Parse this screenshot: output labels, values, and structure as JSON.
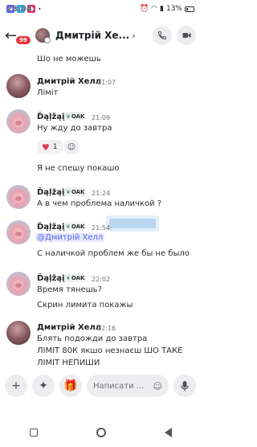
{
  "status_bar": {
    "time": "23:04",
    "battery": "13%"
  },
  "header": {
    "badge": "99",
    "title": "Дмитрій Хе..."
  },
  "messages": [
    {
      "text": "Шо не можешь"
    },
    {
      "author": "Дмитрій Хелл",
      "time": "21:07",
      "text": "Ліміт"
    },
    {
      "author": "Ďąļžąį",
      "tag": "OAK",
      "time": "21:09",
      "text": "Ну жду до завтра",
      "reaction_count": "1"
    },
    {
      "text": "Я не спешу покашо"
    },
    {
      "author": "Ďąļžąį",
      "tag": "OAK",
      "time": "21:24",
      "text": "А в чем проблема наличкой ?"
    },
    {
      "author": "Ďąļžąį",
      "tag": "OAK",
      "time": "21:54",
      "mention": "@Дмитрій Хелл",
      "text": "С наличкой проблем же бы не было"
    },
    {
      "author": "Ďąļžąį",
      "tag": "OAK",
      "time": "22:02",
      "text": "Время тянешь?"
    },
    {
      "text": "Скрин лимита покажы"
    },
    {
      "author": "Дмитрій Хелл",
      "time": "22:16",
      "lines": [
        "Блять подожди до завтра",
        "ЛІМІТ 80К якшо незнаєш ШО ТАКЕ",
        "ЛІМІТ НЕПИШИ"
      ]
    }
  ],
  "input": {
    "placeholder": "Написати ..."
  }
}
